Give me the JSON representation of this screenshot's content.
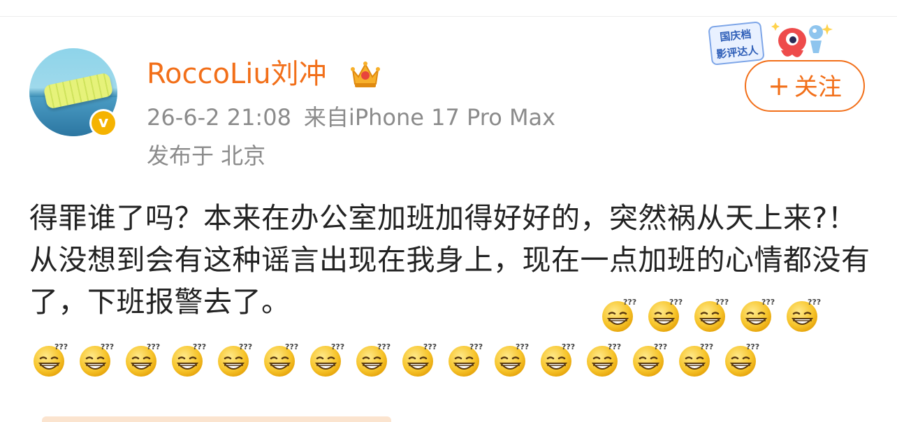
{
  "post": {
    "author": {
      "name": "RoccoLiu刘冲",
      "verified_mark": "v",
      "avatar_icon": "pool-float-avatar",
      "badge_icon": "crown-icon"
    },
    "timestamp": "26-6-2 21:08",
    "source": "来自iPhone 17 Pro Max",
    "location": "发布于 北京",
    "event_badge": {
      "line1": "国庆档",
      "line2": "影评达人"
    },
    "follow_button": {
      "plus": "+",
      "label": "关注"
    },
    "text": "得罪谁了吗？本来在办公室加班加得好好的，突然祸从天上来?！从没想到会有这种谣言出现在我身上，现在一点加班的心情都没有了，下班报警去了。",
    "emoji_name": "dizzy-grin-emoji",
    "emoji_count_row1": 5,
    "emoji_count_row2": 16
  },
  "colors": {
    "accent": "#f26f19",
    "meta": "#8b8b8b",
    "text": "#222222",
    "verified": "#f5b301"
  }
}
